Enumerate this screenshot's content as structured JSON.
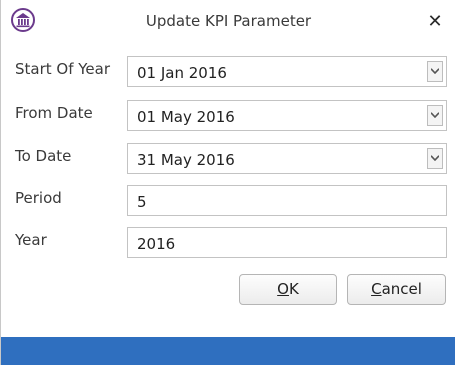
{
  "window": {
    "title": "Update KPI Parameter",
    "close_label": "✕"
  },
  "form": {
    "start_of_year": {
      "label": "Start Of Year",
      "value": "01 Jan 2016"
    },
    "from_date": {
      "label": "From Date",
      "value": "01 May 2016"
    },
    "to_date": {
      "label": "To Date",
      "value": "31 May 2016"
    },
    "period": {
      "label": "Period",
      "value": "5"
    },
    "year": {
      "label": "Year",
      "value": "2016"
    }
  },
  "buttons": {
    "ok": {
      "accel": "O",
      "rest": "K"
    },
    "cancel": {
      "accel": "C",
      "rest": "ancel"
    }
  },
  "colors": {
    "accent": "#2f6fbf",
    "icon": "#6b3a8c"
  }
}
